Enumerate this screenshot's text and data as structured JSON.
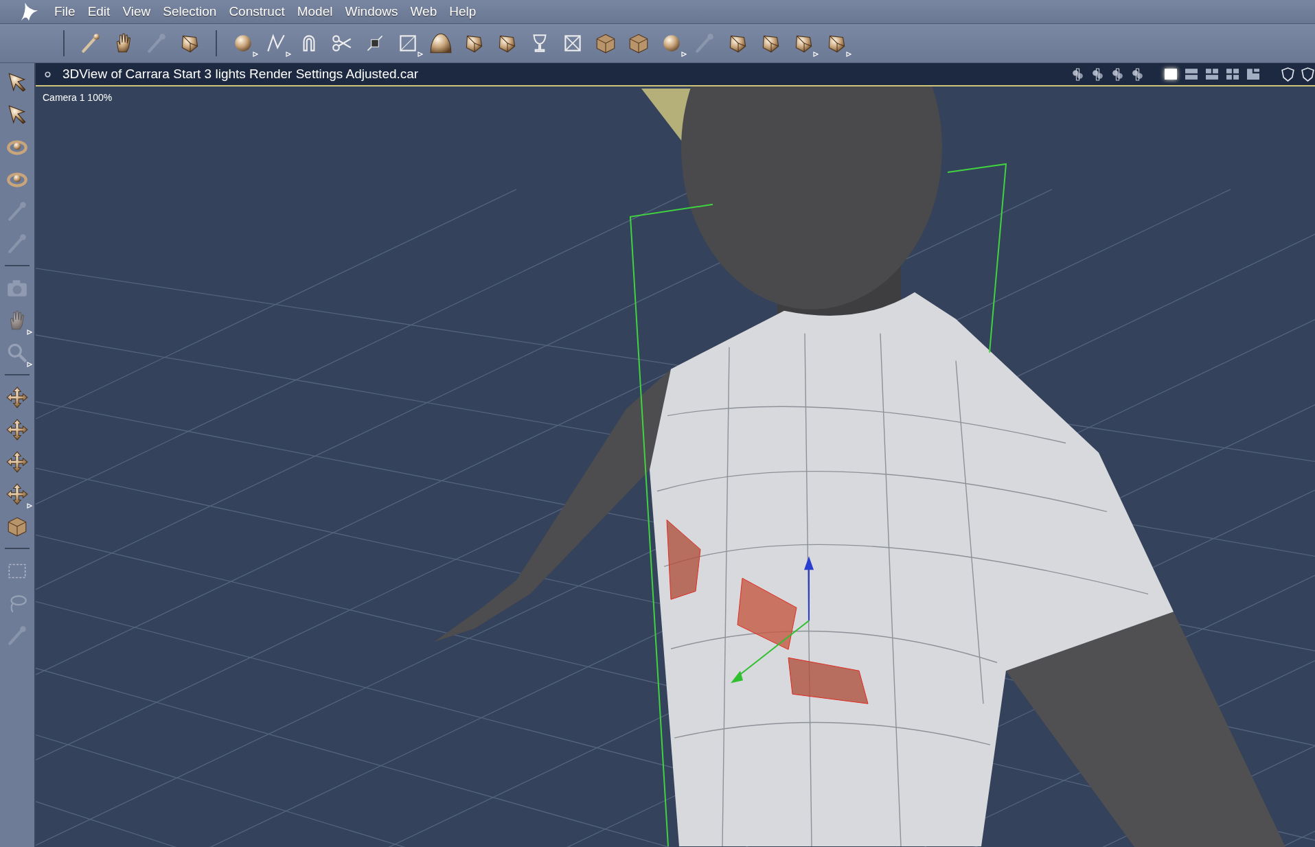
{
  "menu_bar": {
    "items": [
      "File",
      "Edit",
      "View",
      "Selection",
      "Construct",
      "Model",
      "Windows",
      "Web",
      "Help"
    ]
  },
  "toolbar": {
    "groups": [
      [
        {
          "disabled": false,
          "submenu": false
        },
        {
          "disabled": false,
          "submenu": false
        },
        {
          "disabled": true,
          "submenu": false
        },
        {
          "disabled": false,
          "submenu": false
        }
      ],
      [
        {
          "disabled": false,
          "submenu": true
        },
        {
          "disabled": false,
          "submenu": true
        },
        {
          "disabled": false,
          "submenu": false
        },
        {
          "disabled": false,
          "submenu": false
        },
        {
          "disabled": false,
          "submenu": false
        },
        {
          "disabled": false,
          "submenu": true
        },
        {
          "disabled": false,
          "submenu": false
        },
        {
          "disabled": false,
          "submenu": false
        },
        {
          "disabled": false,
          "submenu": false
        },
        {
          "disabled": false,
          "submenu": false
        },
        {
          "disabled": false,
          "submenu": false
        },
        {
          "disabled": false,
          "submenu": false
        },
        {
          "disabled": false,
          "submenu": false
        },
        {
          "disabled": false,
          "submenu": true
        },
        {
          "disabled": true,
          "submenu": false
        },
        {
          "disabled": false,
          "submenu": false
        },
        {
          "disabled": false,
          "submenu": false
        },
        {
          "disabled": false,
          "submenu": true
        },
        {
          "disabled": false,
          "submenu": true
        }
      ]
    ]
  },
  "tool_palette": {
    "groups": [
      [
        {
          "disabled": false,
          "submenu": false
        },
        {
          "disabled": false,
          "submenu": false
        },
        {
          "disabled": false,
          "submenu": false
        },
        {
          "disabled": false,
          "submenu": false
        },
        {
          "disabled": true,
          "submenu": false
        },
        {
          "disabled": true,
          "submenu": false
        }
      ],
      [
        {
          "disabled": true,
          "submenu": false
        },
        {
          "disabled": true,
          "submenu": true
        },
        {
          "disabled": true,
          "submenu": true
        }
      ],
      [
        {
          "disabled": false,
          "submenu": false
        },
        {
          "disabled": false,
          "submenu": false
        },
        {
          "disabled": false,
          "submenu": false
        },
        {
          "disabled": false,
          "submenu": true
        },
        {
          "disabled": false,
          "submenu": false
        }
      ],
      [
        {
          "disabled": true,
          "submenu": false
        },
        {
          "disabled": true,
          "submenu": false
        },
        {
          "disabled": true,
          "submenu": false
        }
      ]
    ]
  },
  "viewport": {
    "title": "3DView of Carrara Start 3 lights Render Settings Adjusted.car",
    "camera_label": "Camera 1 100%",
    "layouts": [
      {
        "selected": true
      },
      {
        "selected": false
      },
      {
        "selected": false
      },
      {
        "selected": false
      },
      {
        "selected": false
      }
    ]
  }
}
